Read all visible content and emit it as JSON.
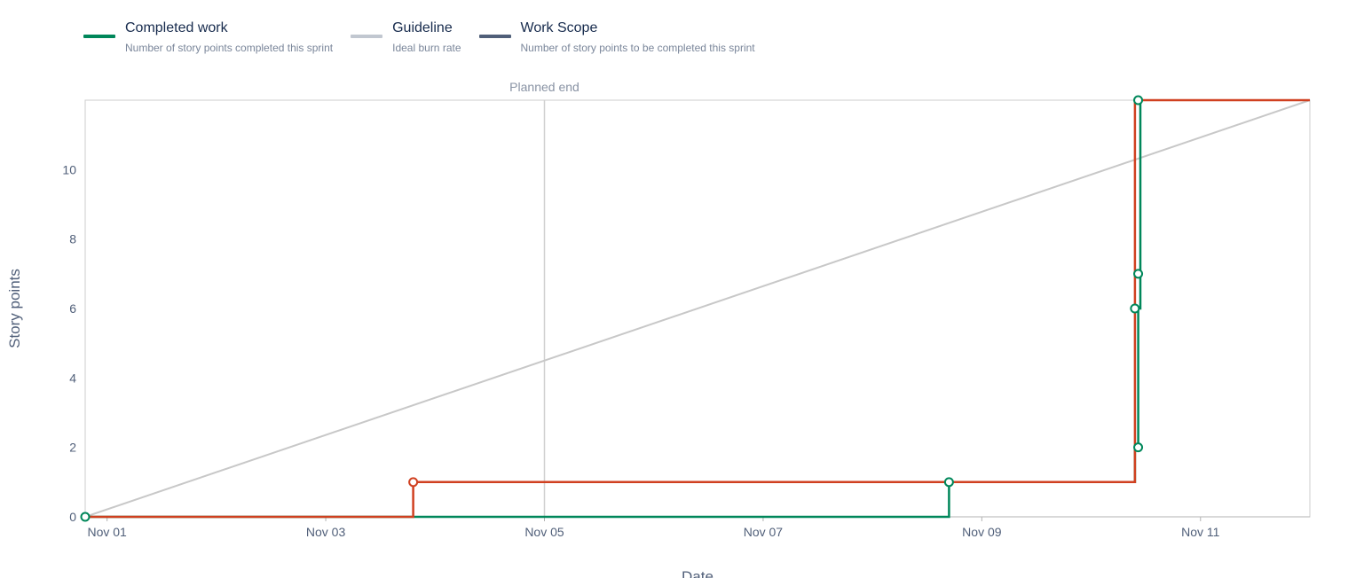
{
  "legend": [
    {
      "title": "Completed work",
      "desc": "Number of story points completed this sprint",
      "color": "#00875a"
    },
    {
      "title": "Guideline",
      "desc": "Ideal burn rate",
      "color": "#c1c7d0"
    },
    {
      "title": "Work Scope",
      "desc": "Number of story points to be completed this sprint",
      "color": "#505f79"
    }
  ],
  "chart_data": {
    "type": "line",
    "ylabel": "Story points",
    "xlabel": "Date",
    "x_ticks": [
      "Nov 01",
      "Nov 03",
      "Nov 05",
      "Nov 07",
      "Nov 09",
      "Nov 11"
    ],
    "x_tick_days": [
      1,
      3,
      5,
      7,
      9,
      11
    ],
    "xlim_days": [
      0.8,
      12.0
    ],
    "ylim": [
      0,
      12
    ],
    "y_ticks": [
      0,
      2,
      4,
      6,
      8,
      10
    ],
    "annotation": {
      "label": "Planned end",
      "day": 5.0
    },
    "series": [
      {
        "name": "Work Scope",
        "color": "#d04020",
        "points": [
          [
            0.8,
            0
          ],
          [
            3.8,
            0
          ],
          [
            3.8,
            1
          ],
          [
            10.4,
            1
          ],
          [
            10.4,
            12
          ],
          [
            12.0,
            12
          ]
        ],
        "markers": [
          [
            3.8,
            1
          ]
        ]
      },
      {
        "name": "Completed work",
        "color": "#00875a",
        "points": [
          [
            0.8,
            0
          ],
          [
            8.7,
            0
          ],
          [
            8.7,
            1
          ],
          [
            10.4,
            1
          ],
          [
            10.4,
            2
          ],
          [
            10.43,
            2
          ],
          [
            10.43,
            6
          ],
          [
            10.45,
            6
          ],
          [
            10.45,
            7
          ],
          [
            10.45,
            12
          ]
        ],
        "markers": [
          [
            0.8,
            0
          ],
          [
            8.7,
            1
          ],
          [
            10.43,
            2
          ],
          [
            10.4,
            6
          ],
          [
            10.43,
            7
          ],
          [
            10.43,
            12
          ]
        ]
      },
      {
        "name": "Guideline",
        "color": "#c8c8c8",
        "points": [
          [
            0.8,
            0
          ],
          [
            12.0,
            12
          ]
        ],
        "markers": []
      }
    ]
  }
}
